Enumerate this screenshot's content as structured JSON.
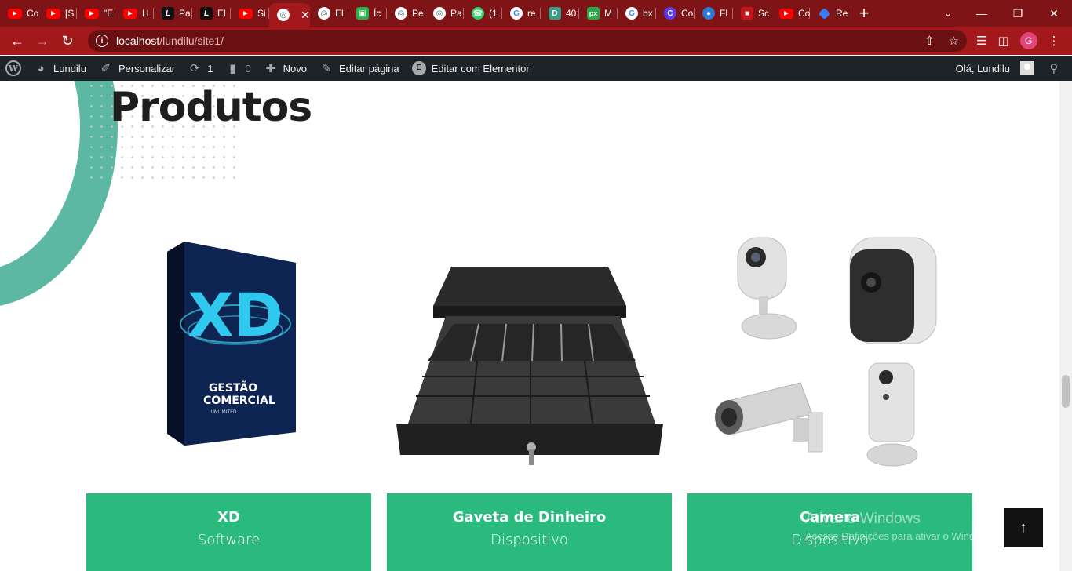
{
  "browser": {
    "tabs": [
      {
        "label": "Co",
        "icon": "youtube-icon"
      },
      {
        "label": "[S",
        "icon": "youtube-icon"
      },
      {
        "label": "\"E",
        "icon": "youtube-icon"
      },
      {
        "label": "H",
        "icon": "youtube-icon"
      },
      {
        "label": "Pa",
        "icon": "elementor-dark-icon"
      },
      {
        "label": "El",
        "icon": "elementor-dark-icon"
      },
      {
        "label": "Si",
        "icon": "youtube-icon"
      },
      {
        "label": "",
        "icon": "globe-icon",
        "active": true
      },
      {
        "label": "El",
        "icon": "globe-icon"
      },
      {
        "label": "Íc",
        "icon": "green-square-icon"
      },
      {
        "label": "Pe",
        "icon": "globe-icon"
      },
      {
        "label": "Pa",
        "icon": "globe-icon"
      },
      {
        "label": "(1",
        "icon": "whatsapp-icon"
      },
      {
        "label": "re",
        "icon": "google-icon"
      },
      {
        "label": "40",
        "icon": "teal-d-icon"
      },
      {
        "label": "M",
        "icon": "px-icon"
      },
      {
        "label": "bx",
        "icon": "google-icon"
      },
      {
        "label": "Co",
        "icon": "canva-icon"
      },
      {
        "label": "Fl",
        "icon": "earth-icon"
      },
      {
        "label": "Sc",
        "icon": "red-icon"
      },
      {
        "label": "Co",
        "icon": "youtube-icon"
      },
      {
        "label": "Re",
        "icon": "blue-diamond-icon"
      }
    ],
    "url_host": "localhost",
    "url_path": "/lundilu/site1/",
    "profile_initial": "G"
  },
  "adminbar": {
    "site_name": "Lundilu",
    "customize": "Personalizar",
    "updates_count": "1",
    "comments_count": "0",
    "new_label": "Novo",
    "edit_page": "Editar página",
    "edit_elementor": "Editar com Elementor",
    "greeting": "Olá, Lundilu"
  },
  "section": {
    "title": "Produtos"
  },
  "products": [
    {
      "name": "XD",
      "category": "Software"
    },
    {
      "name": "Gaveta de Dinheiro",
      "category": "Dispositivo"
    },
    {
      "name": "Camera",
      "category": "Dispositivo"
    }
  ],
  "xd_box": {
    "logo": "XD",
    "line1": "GESTÃO",
    "line2": "COMERCIAL",
    "line3": "UNLIMITED"
  },
  "watermark": {
    "title": "Ativar o Windows",
    "subtitle": "Acesse Definições para ativar o Windows."
  },
  "colors": {
    "card_bg": "#2bba7e",
    "ring": "#5cb8a3",
    "chrome_frame": "#7f1416"
  }
}
